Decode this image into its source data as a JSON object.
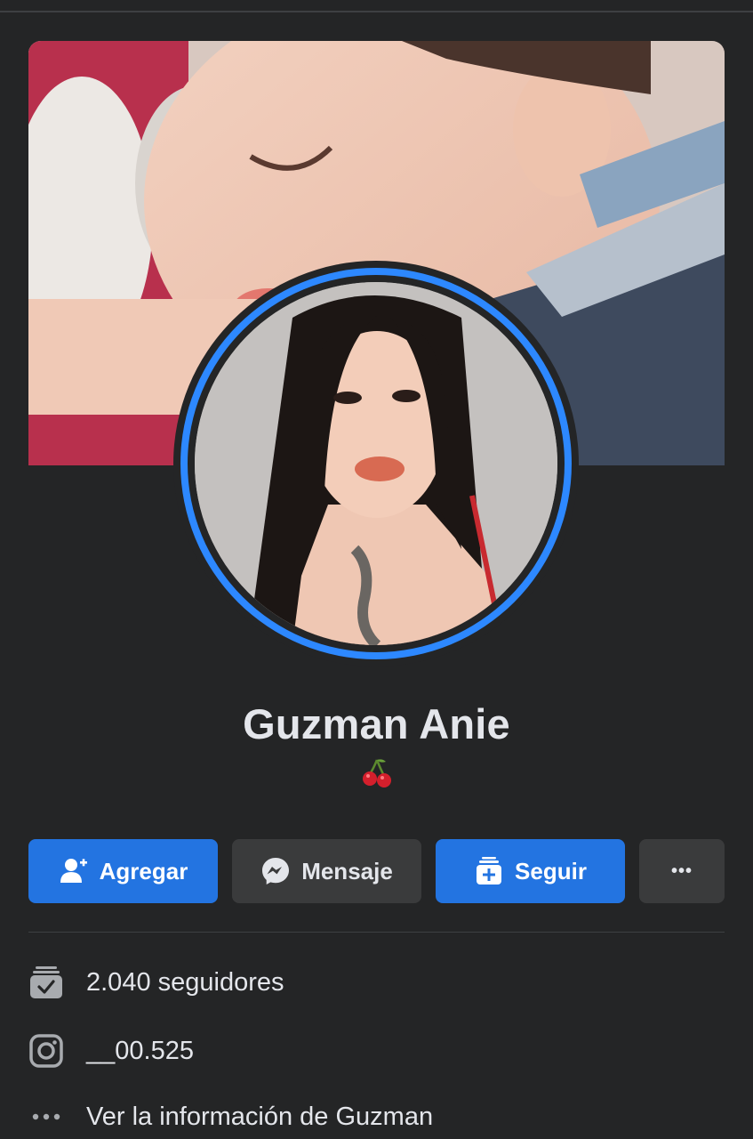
{
  "profile": {
    "name": "Guzman Anie",
    "bio_emoji": "cherries-emoji"
  },
  "actions": {
    "add_label": "Agregar",
    "message_label": "Mensaje",
    "follow_label": "Seguir",
    "more_label": "•••"
  },
  "details": {
    "followers": "2.040 seguidores",
    "instagram": "__00.525",
    "see_info": "Ver la información de Guzman"
  },
  "icons": {
    "add": "add-friend-icon",
    "message": "messenger-icon",
    "follow": "follow-icon",
    "more": "more-options-icon",
    "followers": "followers-icon",
    "instagram": "instagram-icon",
    "info": "more-info-icon"
  },
  "colors": {
    "background": "#242526",
    "primary_button": "#2374e1",
    "secondary_button": "#3a3b3c",
    "avatar_ring": "#2d88ff",
    "text": "#e4e6eb"
  }
}
